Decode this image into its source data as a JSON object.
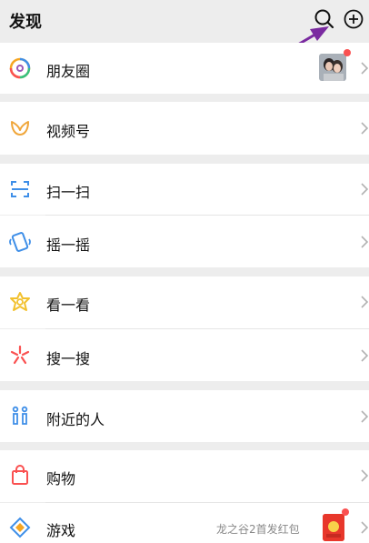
{
  "header": {
    "title": "发现"
  },
  "menu": [
    {
      "label": "朋友圈",
      "icon": "moments-icon"
    },
    {
      "label": "视频号",
      "icon": "channels-icon"
    },
    {
      "label": "扫一扫",
      "icon": "scan-icon"
    },
    {
      "label": "摇一摇",
      "icon": "shake-icon"
    },
    {
      "label": "看一看",
      "icon": "top-stories-icon"
    },
    {
      "label": "搜一搜",
      "icon": "search-feature-icon"
    },
    {
      "label": "附近的人",
      "icon": "people-nearby-icon"
    },
    {
      "label": "购物",
      "icon": "shopping-icon"
    },
    {
      "label": "游戏",
      "icon": "games-icon",
      "extra": "龙之谷2首发红包"
    }
  ],
  "colors": {
    "background": "#ededed",
    "arrow": "#7a2aa0",
    "badge": "#fa5151"
  }
}
